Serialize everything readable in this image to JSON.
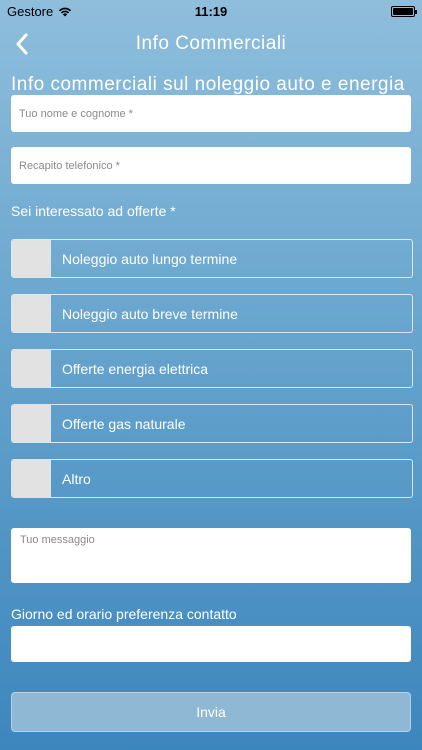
{
  "status_bar": {
    "carrier": "Gestore",
    "time": "11:19"
  },
  "nav": {
    "title": "Info Commerciali"
  },
  "banner": "Info commerciali sul noleggio auto e energia",
  "form": {
    "name_placeholder": "Tuo nome e cognome *",
    "phone_placeholder": "Recapito telefonico *",
    "offers_label": "Sei interessato ad offerte *",
    "offers": [
      {
        "label": "Noleggio auto lungo termine",
        "checked": false
      },
      {
        "label": "Noleggio auto breve termine",
        "checked": false
      },
      {
        "label": "Offerte energia elettrica",
        "checked": false
      },
      {
        "label": "Offerte gas naturale",
        "checked": false
      },
      {
        "label": "Altro",
        "checked": false
      }
    ],
    "message_placeholder": "Tuo messaggio",
    "contact_time_label": "Giorno ed orario preferenza contatto",
    "contact_time_value": "",
    "submit_label": "Invia"
  },
  "colors": {
    "background_top": "#8fbedc",
    "background_bottom": "#3d86bd",
    "checkbox_fill": "#e2e2e2",
    "submit_button": "#8fb8d4"
  }
}
